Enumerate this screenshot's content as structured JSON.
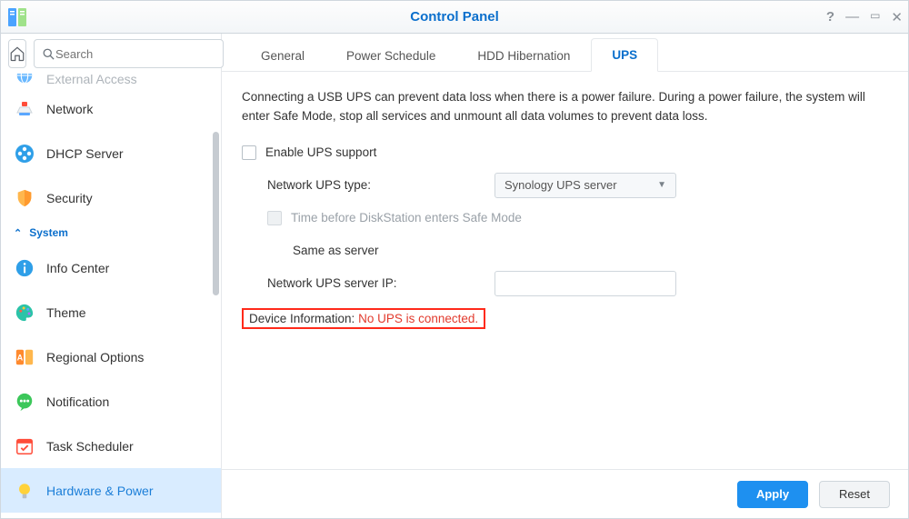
{
  "window": {
    "title": "Control Panel"
  },
  "search": {
    "placeholder": "Search"
  },
  "sidebar": {
    "clipped_label": "External Access",
    "items": [
      {
        "label": "Network"
      },
      {
        "label": "DHCP Server"
      },
      {
        "label": "Security"
      }
    ],
    "section": "System",
    "system_items": [
      {
        "label": "Info Center"
      },
      {
        "label": "Theme"
      },
      {
        "label": "Regional Options"
      },
      {
        "label": "Notification"
      },
      {
        "label": "Task Scheduler"
      },
      {
        "label": "Hardware & Power"
      }
    ]
  },
  "tabs": [
    {
      "label": "General"
    },
    {
      "label": "Power Schedule"
    },
    {
      "label": "HDD Hibernation"
    },
    {
      "label": "UPS"
    }
  ],
  "ups": {
    "description": "Connecting a USB UPS can prevent data loss when there is a power failure. During a power failure, the system will enter Safe Mode, stop all services and unmount all data volumes to prevent data loss.",
    "enable_label": "Enable UPS support",
    "type_label": "Network UPS type:",
    "type_value": "Synology UPS server",
    "safemode_label": "Time before DiskStation enters Safe Mode",
    "same_label": "Same as server",
    "serverip_label": "Network UPS server IP:",
    "serverip_value": "",
    "devinfo_label": "Device Information:",
    "devinfo_status": "No UPS is connected."
  },
  "footer": {
    "apply": "Apply",
    "reset": "Reset"
  }
}
